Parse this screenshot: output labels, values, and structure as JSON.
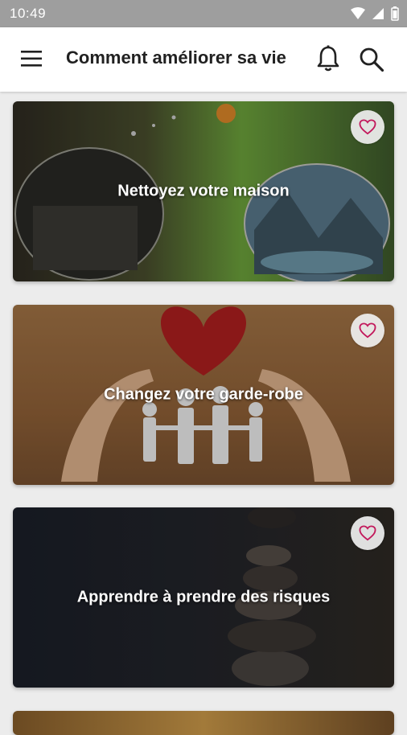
{
  "status_bar": {
    "time": "10:49"
  },
  "app_bar": {
    "title": "Comment améliorer sa vie"
  },
  "icons": {
    "menu": "hamburger-menu-icon",
    "notifications": "bell-icon",
    "search": "search-icon",
    "favorite": "heart-outline-icon"
  },
  "colors": {
    "accent": "#c2185b",
    "app_bar": "#ffffff",
    "status_bar": "#9e9e9e"
  },
  "cards": [
    {
      "title": "Nettoyez votre maison"
    },
    {
      "title": "Changez votre garde-robe"
    },
    {
      "title": "Apprendre à prendre des risques"
    }
  ]
}
